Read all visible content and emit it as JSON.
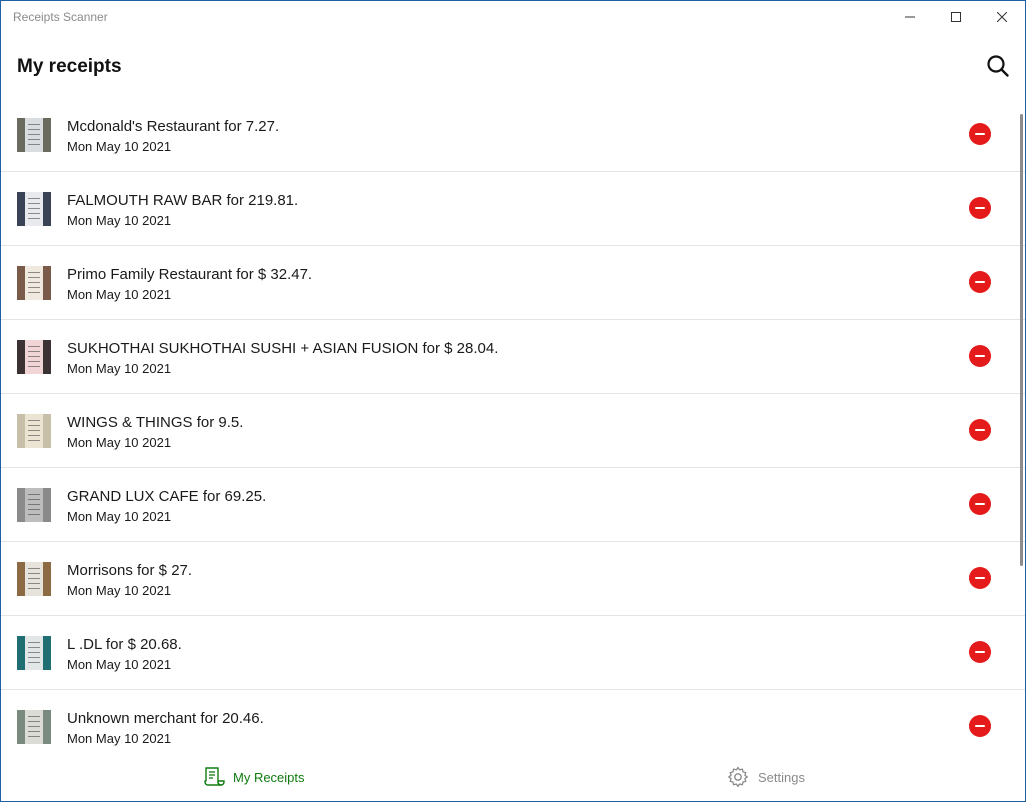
{
  "window": {
    "title": "Receipts Scanner"
  },
  "header": {
    "title": "My receipts"
  },
  "receipts": [
    {
      "merchant_line": "Mcdonald's Restaurant for 7.27.",
      "date": "Mon May 10 2021",
      "thumb_color": "#d9dde0",
      "thumb_bg": "#6a6a5e"
    },
    {
      "merchant_line": "FALMOUTH RAW BAR for 219.81.",
      "date": "Mon May 10 2021",
      "thumb_color": "#e8eaee",
      "thumb_bg": "#3a4256"
    },
    {
      "merchant_line": "Primo Family Restaurant for $ 32.47.",
      "date": "Mon May 10 2021",
      "thumb_color": "#efe9df",
      "thumb_bg": "#7a5a48"
    },
    {
      "merchant_line": "SUKHOTHAI SUKHOTHAI SUSHI + ASIAN FUSION for $ 28.04.",
      "date": "Mon May 10 2021",
      "thumb_color": "#f1d4d6",
      "thumb_bg": "#3c3234"
    },
    {
      "merchant_line": "WINGS & THINGS for 9.5.",
      "date": "Mon May 10 2021",
      "thumb_color": "#ece4d2",
      "thumb_bg": "#c8bfa8"
    },
    {
      "merchant_line": "GRAND LUX CAFE for 69.25.",
      "date": "Mon May 10 2021",
      "thumb_color": "#bdbdbd",
      "thumb_bg": "#8a8a8a"
    },
    {
      "merchant_line": "Morrisons for $ 27.",
      "date": "Mon May 10 2021",
      "thumb_color": "#e6e3dc",
      "thumb_bg": "#8b6a44"
    },
    {
      "merchant_line": "L .DL for $ 20.68.",
      "date": "Mon May 10 2021",
      "thumb_color": "#e3e6e6",
      "thumb_bg": "#1f6e72"
    },
    {
      "merchant_line": "Unknown merchant for 20.46.",
      "date": "Mon May 10 2021",
      "thumb_color": "#dcdcd6",
      "thumb_bg": "#7a8a7e"
    }
  ],
  "nav": {
    "receipts_label": "My Receipts",
    "settings_label": "Settings",
    "receipts_icon": "receipt-icon",
    "settings_icon": "gear-icon"
  },
  "colors": {
    "accent_green": "#107c10",
    "delete_red": "#e51a1a"
  }
}
